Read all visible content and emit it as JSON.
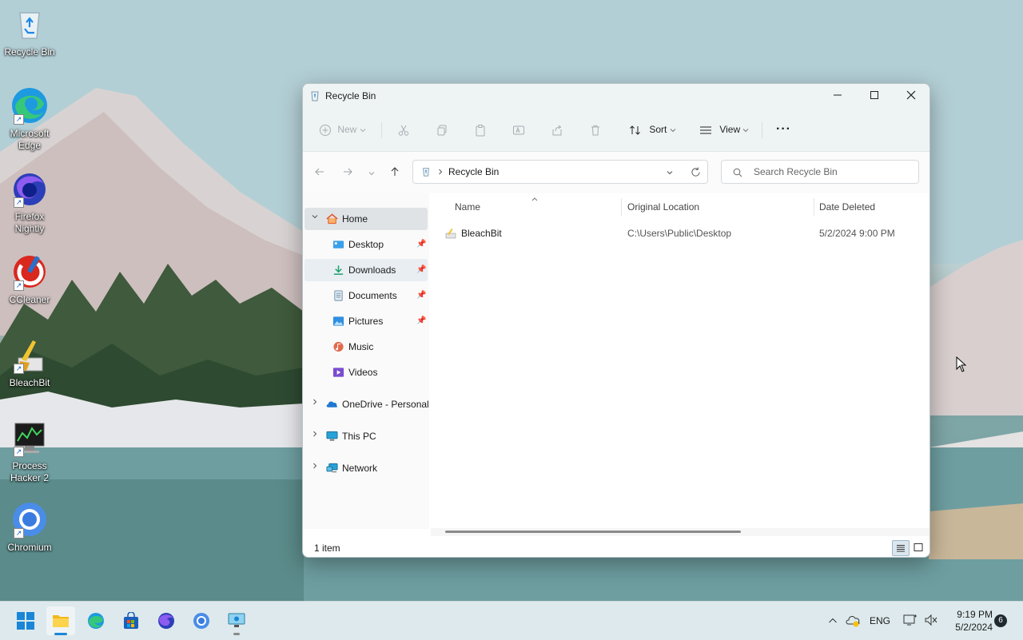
{
  "desktop": {
    "icons": [
      {
        "label": "Recycle Bin"
      },
      {
        "label": "Microsoft Edge"
      },
      {
        "label": "Firefox Nightly"
      },
      {
        "label": "CCleaner"
      },
      {
        "label": "BleachBit"
      },
      {
        "label": "Process Hacker 2"
      },
      {
        "label": "Chromium"
      }
    ]
  },
  "window": {
    "title": "Recycle Bin",
    "commandbar": {
      "new_label": "New",
      "sort_label": "Sort",
      "view_label": "View",
      "more_label": "···"
    },
    "address": {
      "path_label": "Recycle Bin",
      "search_placeholder": "Search Recycle Bin"
    },
    "nav": {
      "home": "Home",
      "items": [
        {
          "label": "Desktop"
        },
        {
          "label": "Downloads"
        },
        {
          "label": "Documents"
        },
        {
          "label": "Pictures"
        },
        {
          "label": "Music"
        },
        {
          "label": "Videos"
        }
      ],
      "onedrive": "OneDrive - Personal",
      "thispc": "This PC",
      "network": "Network"
    },
    "columns": {
      "name": "Name",
      "original_location": "Original Location",
      "date_deleted": "Date Deleted"
    },
    "rows": [
      {
        "name": "BleachBit",
        "original_location": "C:\\Users\\Public\\Desktop",
        "date_deleted": "5/2/2024 9:00 PM"
      }
    ],
    "status": {
      "item_count": "1 item"
    }
  },
  "taskbar": {
    "language": "ENG",
    "time": "9:19 PM",
    "date": "5/2/2024",
    "notification_count": "6"
  }
}
